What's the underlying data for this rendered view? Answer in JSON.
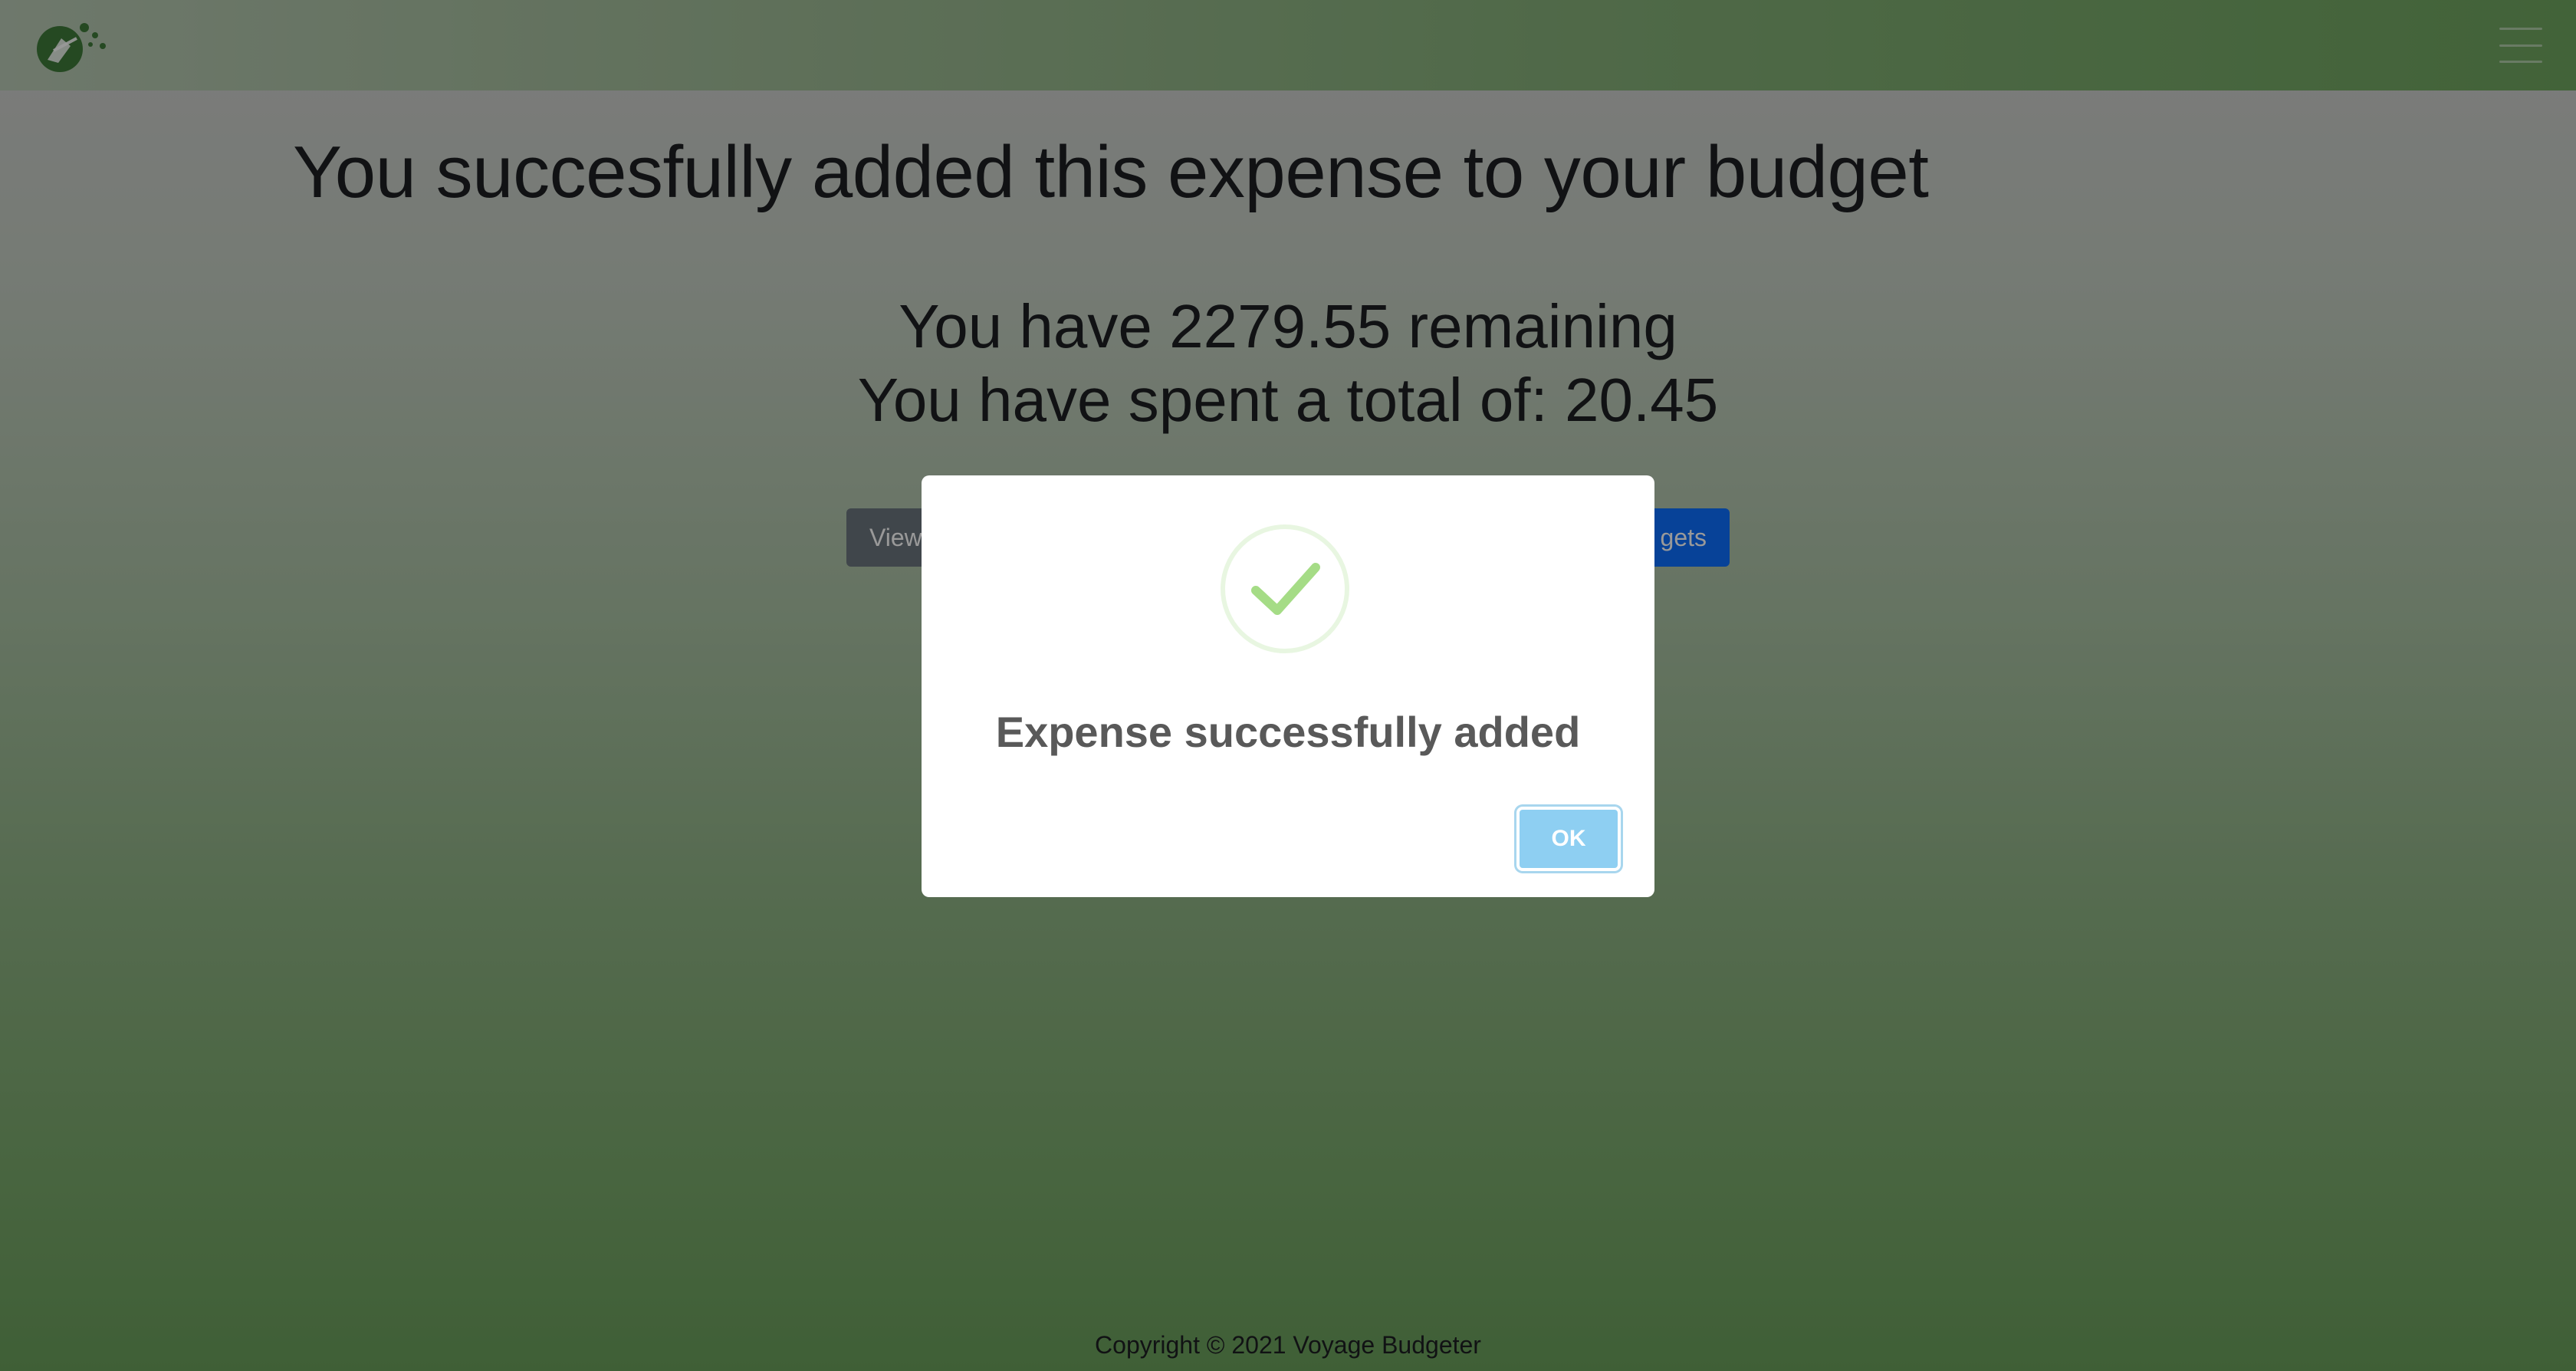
{
  "main": {
    "title": "You succesfully added this expense to your budget",
    "remaining_line": "You have 2279.55 remaining",
    "spent_line": "You have spent a total of: 20.45",
    "buttons": {
      "view_label": "View",
      "budgets_label": "gets"
    }
  },
  "footer": {
    "copyright": "Copyright © 2021 Voyage Budgeter"
  },
  "modal": {
    "icon": "success-check",
    "title": "Expense successfully added",
    "ok_label": "OK"
  },
  "colors": {
    "navbar": "#6fa55f",
    "modal_bg": "#ffffff",
    "ok_button": "#8ecff2",
    "check": "#a5dc86",
    "view_button": "#6c757d",
    "budgets_button": "#0d6efd"
  }
}
